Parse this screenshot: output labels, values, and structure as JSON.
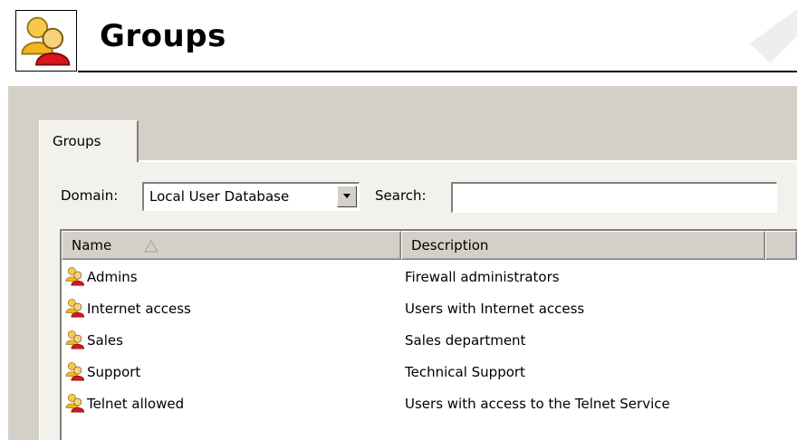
{
  "header": {
    "title": "Groups",
    "icon": "groups-icon"
  },
  "tabs": [
    {
      "label": "Groups",
      "selected": true
    }
  ],
  "filter": {
    "domain_label": "Domain:",
    "domain_value": "Local User Database",
    "search_label": "Search:",
    "search_value": ""
  },
  "list": {
    "columns": [
      {
        "label": "Name",
        "sort": "ascending"
      },
      {
        "label": "Description"
      },
      {
        "label": ""
      }
    ],
    "rows": [
      {
        "icon": "group-icon",
        "name": "Admins",
        "description": "Firewall administrators"
      },
      {
        "icon": "group-icon",
        "name": "Internet access",
        "description": "Users with Internet access"
      },
      {
        "icon": "group-icon",
        "name": "Sales",
        "description": "Sales department"
      },
      {
        "icon": "group-icon",
        "name": "Support",
        "description": "Technical Support"
      },
      {
        "icon": "group-icon",
        "name": "Telnet allowed",
        "description": "Users with access to the Telnet Service"
      }
    ]
  },
  "colors": {
    "panel_bg": "#d4d0c8",
    "tab_bg": "#f3f1ec",
    "icon_yellow": "#f2b51c",
    "icon_red": "#d9161c"
  }
}
